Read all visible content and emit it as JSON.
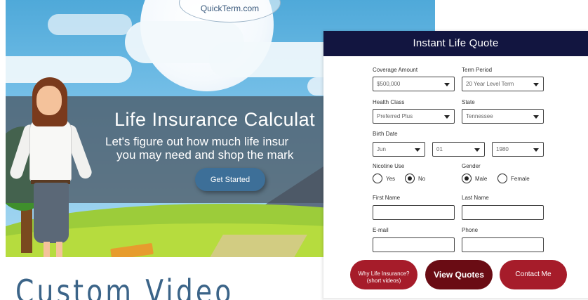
{
  "hero": {
    "brand": "QuickTerm.com",
    "title": "Life Insurance Calculat",
    "subtitle_line1": "Let's figure out how much life insur",
    "subtitle_line2": "you may need and shop the mark",
    "cta_label": "Get Started"
  },
  "section_heading": "Custom Video",
  "quote_form": {
    "title": "Instant Life Quote",
    "coverage_amount": {
      "label": "Coverage Amount",
      "value": "$500,000"
    },
    "term_period": {
      "label": "Term Period",
      "value": "20 Year Level Term"
    },
    "health_class": {
      "label": "Health Class",
      "value": "Preferred Plus"
    },
    "state": {
      "label": "State",
      "value": "Tennessee"
    },
    "birth_date": {
      "label": "Birth Date",
      "month": "Jun",
      "day": "01",
      "year": "1980"
    },
    "nicotine_use": {
      "label": "Nicotine Use",
      "options": [
        "Yes",
        "No"
      ],
      "selected": "No"
    },
    "gender": {
      "label": "Gender",
      "options": [
        "Male",
        "Female"
      ],
      "selected": "Male"
    },
    "first_name": {
      "label": "First Name",
      "value": ""
    },
    "last_name": {
      "label": "Last Name",
      "value": ""
    },
    "email": {
      "label": "E-mail",
      "value": ""
    },
    "phone": {
      "label": "Phone",
      "value": ""
    },
    "buttons": {
      "why_line1": "Why Life Insurance?",
      "why_line2": "(short videos)",
      "view_quotes": "View Quotes",
      "contact_me": "Contact Me"
    }
  },
  "colors": {
    "header_navy": "#121540",
    "button_red": "#a61c2a",
    "button_dark_red": "#6a0c14",
    "cta_blue": "#3d6f98",
    "heading_blue": "#3b6488"
  }
}
